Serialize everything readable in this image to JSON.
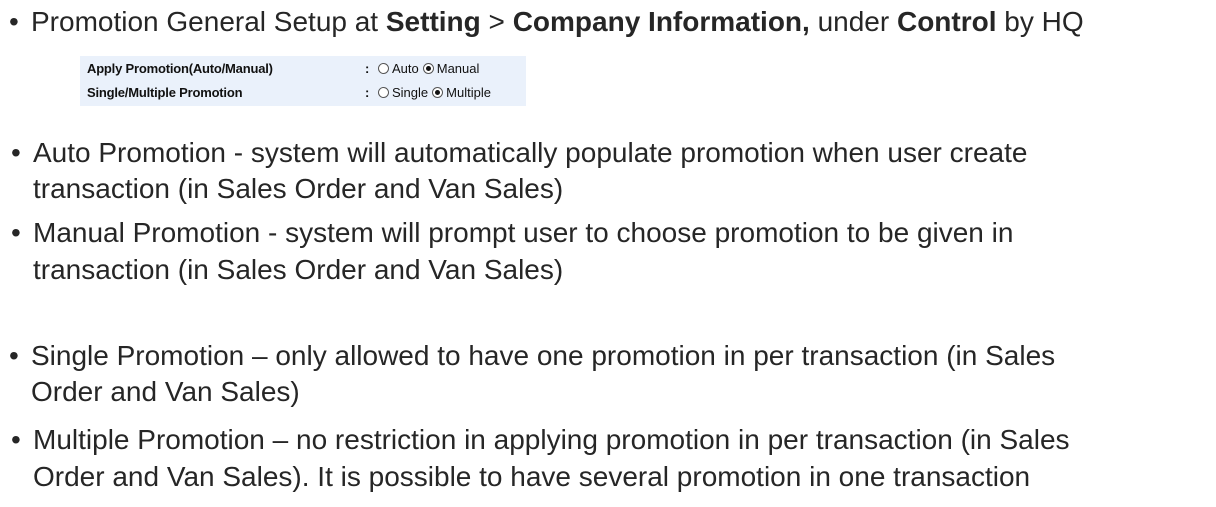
{
  "heading": {
    "prefix": "Promotion General Setup at ",
    "setting": "Setting",
    "sep": " > ",
    "company_info": "Company Information,",
    "under": " under ",
    "control": "Control",
    "suffix": " by HQ"
  },
  "settings": {
    "rows": [
      {
        "label": "Apply Promotion(Auto/Manual)",
        "colon": ":",
        "options": [
          {
            "label": "Auto",
            "checked": false
          },
          {
            "label": "Manual",
            "checked": true
          }
        ]
      },
      {
        "label": "Single/Multiple Promotion",
        "colon": ":",
        "options": [
          {
            "label": "Single",
            "checked": false
          },
          {
            "label": "Multiple",
            "checked": true
          }
        ]
      }
    ]
  },
  "bullets": {
    "auto": {
      "line1": "Auto Promotion - system will automatically populate promotion when user create",
      "line2": "transaction (in Sales Order and Van Sales)"
    },
    "manual": {
      "line1": "Manual Promotion - system will prompt user to choose promotion to be given in",
      "line2": "transaction (in Sales Order and Van Sales)"
    },
    "single": {
      "line1": "Single Promotion – only allowed to have one promotion in per transaction (in Sales",
      "line2": "Order and Van Sales)"
    },
    "multiple": {
      "line1": "Multiple Promotion – no restriction in applying promotion in per transaction (in Sales",
      "line2": "Order and Van Sales). It is possible to have several promotion in one transaction"
    }
  },
  "bullet_char": "•"
}
